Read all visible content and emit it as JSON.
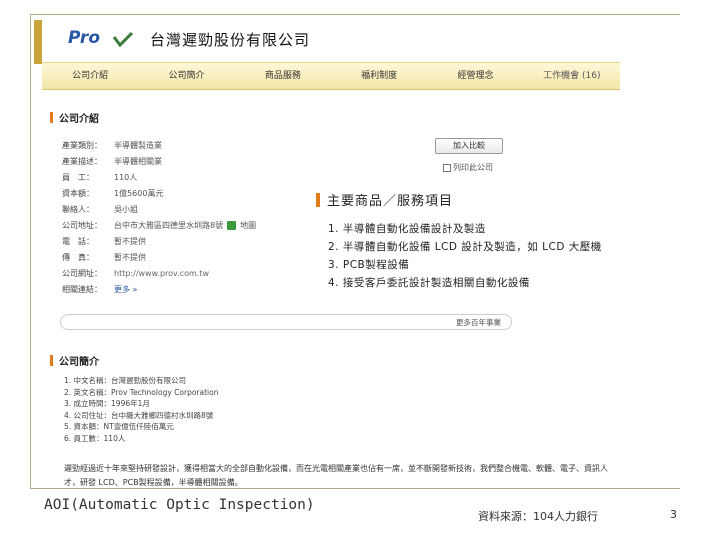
{
  "header": {
    "logo_text": "Pro",
    "company_name": "台灣遲勁股份有限公司"
  },
  "nav": {
    "items": [
      "公司介紹",
      "公司簡介",
      "商品服務",
      "福利制度",
      "經營理念",
      "工作機會 (16)"
    ]
  },
  "company_intro": {
    "title": "公司介紹",
    "rows": [
      {
        "label": "產業類別：",
        "value": "半導體製造業"
      },
      {
        "label": "產業描述：",
        "value": "半導體相關業"
      },
      {
        "label": "員　工：",
        "value": "110人"
      },
      {
        "label": "資本額：",
        "value": "1億5600萬元"
      },
      {
        "label": "聯絡人：",
        "value": "吳小姐"
      },
      {
        "label": "公司地址：",
        "value": "台中市大雅區四德里水圳路8號",
        "map_label": "地圖"
      },
      {
        "label": "電　話：",
        "value": "暫不提供"
      },
      {
        "label": "傳　真：",
        "value": "暫不提供"
      },
      {
        "label": "公司網址：",
        "value": "http://www.prov.com.tw"
      },
      {
        "label": "相關連結：",
        "value": "更多 »"
      }
    ],
    "compare_button": "加入比較",
    "print_link": "列印此公司"
  },
  "products": {
    "title": "主要商品／服務項目",
    "items": [
      "1. 半導體自動化設備設計及製造",
      "2. 半導體自動化設備 LCD 設計及製造，如 LCD 大壓機",
      "3. PCB製程設備",
      "4. 接受客戶委託設計製造相關自動化設備"
    ]
  },
  "search_bar": {
    "link_label": "更多百年事業"
  },
  "company_profile": {
    "title": "公司簡介",
    "items": [
      "1. 中文名稱：台灣遲勁股份有限公司",
      "2. 英文名稱：Prov Technology Corporation",
      "3. 成立時間：1996年1月",
      "4. 公司住址：台中縣大雅鄉四德村水圳路8號",
      "5. 資本額：NT壹億伍仟陸佰萬元",
      "6. 員工數：110人"
    ],
    "description": "遲勁經過近十年來堅持研發設計，獲得相當大的全部自動化設備，而在光電相關產業也佔有一席，並不斷開發新技術，我們整合機電、軟體、電子、資訊人才，研發 LCD、PCB製程設備，半導體相關設備。"
  },
  "footer": {
    "caption": "AOI(Automatic Optic Inspection)",
    "source": "資料來源：104人力銀行",
    "page_number": "3"
  },
  "colors": {
    "accent_bar": "#e07a1a",
    "nav_background": "#f2e5a6",
    "slide_accent": "#c9a43a",
    "logo_blue": "#2a56a6"
  }
}
